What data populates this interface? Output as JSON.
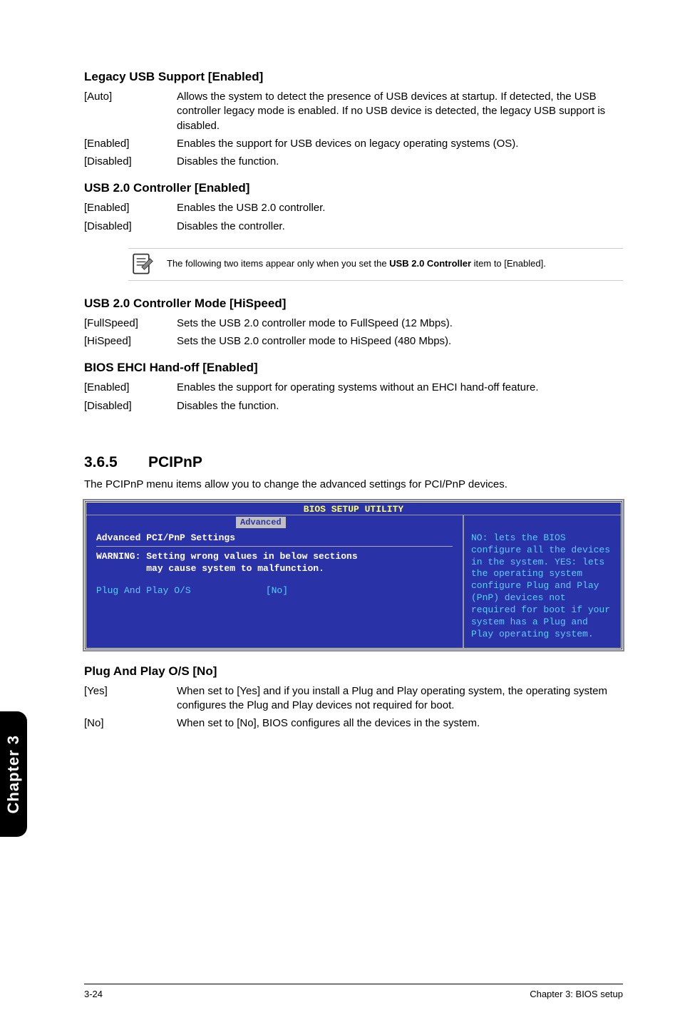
{
  "sections": {
    "legacy_usb": {
      "title": "Legacy USB Support [Enabled]",
      "opts": [
        {
          "key": "[Auto]",
          "desc": "Allows the system to detect the presence of USB devices at startup. If detected, the USB controller legacy mode is enabled. If no USB device is detected, the legacy USB support is disabled."
        },
        {
          "key": "[Enabled]",
          "desc": "Enables the support for USB devices on legacy operating systems (OS)."
        },
        {
          "key": "[Disabled]",
          "desc": "Disables the function."
        }
      ]
    },
    "usb20_ctrl": {
      "title": "USB 2.0 Controller [Enabled]",
      "opts": [
        {
          "key": "[Enabled]",
          "desc": "Enables the USB 2.0 controller."
        },
        {
          "key": "[Disabled]",
          "desc": "Disables the controller."
        }
      ]
    },
    "note": {
      "text_a": "The following two items appear only when you set the ",
      "bold": "USB 2.0 Controller",
      "text_b": " item to [Enabled]."
    },
    "usb20_mode": {
      "title": "USB 2.0 Controller Mode [HiSpeed]",
      "opts": [
        {
          "key": "[FullSpeed]",
          "desc": "Sets the USB 2.0 controller mode to FullSpeed (12 Mbps)."
        },
        {
          "key": "[HiSpeed]",
          "desc": "Sets the USB 2.0 controller mode to HiSpeed (480 Mbps)."
        }
      ]
    },
    "ehci": {
      "title": "BIOS EHCI Hand-off [Enabled]",
      "opts": [
        {
          "key": "[Enabled]",
          "desc": "Enables the support for operating systems without an EHCI hand-off feature."
        },
        {
          "key": "[Disabled]",
          "desc": "Disables the function."
        }
      ]
    },
    "pcipnp_heading": {
      "num": "3.6.5",
      "title": "PCIPnP",
      "intro": "The PCIPnP menu items allow you to change the advanced settings for PCI/PnP devices."
    },
    "bios": {
      "title": "BIOS SETUP UTILITY",
      "tab": "Advanced",
      "heading": "Advanced PCI/PnP Settings",
      "warn1": "WARNING: Setting wrong values in below sections",
      "warn2": "         may cause system to malfunction.",
      "setting_label": "Plug And Play O/S",
      "setting_value": "[No]",
      "help": "NO: lets the BIOS configure all the devices in the system. YES: lets the operating system configure Plug and Play (PnP) devices not required for boot if your system has a Plug and Play operating system."
    },
    "pnp": {
      "title": "Plug And Play O/S [No]",
      "opts": [
        {
          "key": "[Yes]",
          "desc": "When set to [Yes] and if you install a Plug and Play operating system, the operating system configures the Plug and Play devices not required for boot."
        },
        {
          "key": "[No]",
          "desc": "When set to [No], BIOS configures all the devices in the system."
        }
      ]
    }
  },
  "sidebar": "Chapter 3",
  "footer": {
    "left": "3-24",
    "right": "Chapter 3: BIOS setup"
  }
}
